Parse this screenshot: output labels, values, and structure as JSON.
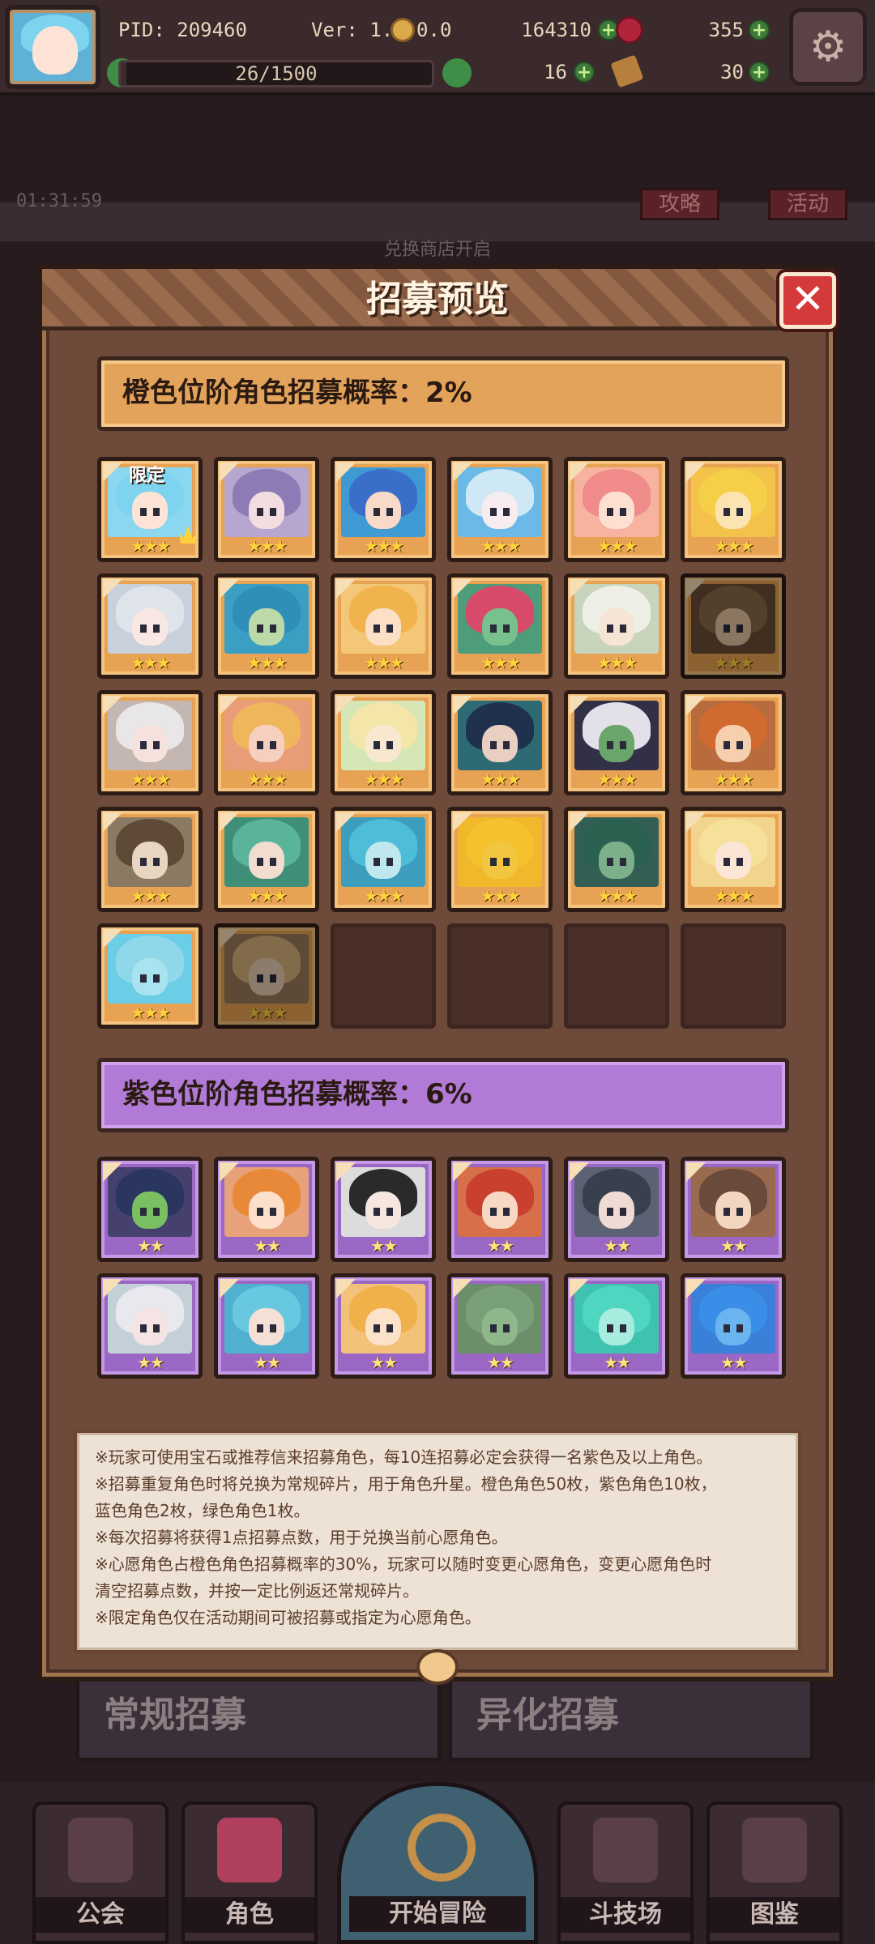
{
  "hud": {
    "pid": "PID: 209460",
    "version": "Ver: 1.0.0.0",
    "coins": "164310",
    "gems": "355",
    "exp": "26/1500",
    "exp_fraction": 0.017,
    "clover_count": "16",
    "ticket_count": "30",
    "plus_symbol": "+",
    "settings_icon": "gear-icon"
  },
  "background": {
    "timer": "01:31:59",
    "shop_notice": "兑换商店开启",
    "tags": [
      "攻略",
      "活动"
    ],
    "recruit_buttons": [
      "常规招募",
      "异化招募"
    ]
  },
  "popup": {
    "title": "招募预览",
    "close_symbol": "✕",
    "orange_tier_label": "橙色位阶角色招募概率：2%",
    "purple_tier_label": "紫色位阶角色招募概率：6%",
    "limited_tag": "限定",
    "orange_stars": "★★★",
    "purple_stars": "★★",
    "orange_characters": [
      {
        "hair": "#7ed4ee",
        "bg": "#8ad7ef",
        "skin": "#fde4d6",
        "limited": true
      },
      {
        "hair": "#8c7bb4",
        "bg": "#b7a6cf",
        "skin": "#f3dde0"
      },
      {
        "hair": "#3a6fc9",
        "bg": "#3f9ad4",
        "skin": "#f9d9c8"
      },
      {
        "hair": "#cfe8f6",
        "bg": "#6ab9e6",
        "skin": "#f7ecef"
      },
      {
        "hair": "#f08c8a",
        "bg": "#f7b3a0",
        "skin": "#fde0d2"
      },
      {
        "hair": "#f6cf48",
        "bg": "#f3c24a",
        "skin": "#fbe4b2"
      },
      {
        "hair": "#dfe3ea",
        "bg": "#c8d0dc",
        "skin": "#f8e7e2"
      },
      {
        "hair": "#2f8fb9",
        "bg": "#3a9fc2",
        "skin": "#bcd9a8"
      },
      {
        "hair": "#f0b34d",
        "bg": "#f4c778",
        "skin": "#fbe0c6"
      },
      {
        "hair": "#d84a6a",
        "bg": "#4d9c7a",
        "skin": "#78c08e"
      },
      {
        "hair": "#eef0e8",
        "bg": "#c9d4bd",
        "skin": "#f6e4d4"
      },
      {
        "hair": "#8a6a4a",
        "bg": "#6a4d36",
        "skin": "#e7c4a2",
        "dim": true
      },
      {
        "hair": "#e8e6e6",
        "bg": "#c4b6b0",
        "skin": "#f6e2dc"
      },
      {
        "hair": "#f0b65c",
        "bg": "#e89d78",
        "skin": "#f6cfbf"
      },
      {
        "hair": "#f4e6a8",
        "bg": "#d7e6b5",
        "skin": "#f9e8d0"
      },
      {
        "hair": "#20314e",
        "bg": "#2e6a74",
        "skin": "#e8cfc2"
      },
      {
        "hair": "#e4e0ea",
        "bg": "#313046",
        "skin": "#6aa56a"
      },
      {
        "hair": "#d16a2e",
        "bg": "#b86b3d",
        "skin": "#f6cfae"
      },
      {
        "hair": "#5e4a36",
        "bg": "#8a7a62",
        "skin": "#e9d6c2"
      },
      {
        "hair": "#5ab49a",
        "bg": "#3f8e78",
        "skin": "#f2dcd0"
      },
      {
        "hair": "#4ebdd8",
        "bg": "#3d9dbc",
        "skin": "#bfe7ee"
      },
      {
        "hair": "#f5c22e",
        "bg": "#f1b82c",
        "skin": "#f3c640"
      },
      {
        "hair": "#2a6050",
        "bg": "#325e54",
        "skin": "#7cb08a"
      },
      {
        "hair": "#f6e19a",
        "bg": "#f3d48c",
        "skin": "#fbe6d6"
      },
      {
        "hair": "#8fd8ea",
        "bg": "#6ccde6",
        "skin": "#a9e3ef"
      },
      {
        "hair": "#d8b37c",
        "bg": "#9a7a5a",
        "skin": "#e8cfb4",
        "dim": true
      }
    ],
    "orange_empty_slots": 4,
    "purple_characters": [
      {
        "hair": "#2a3560",
        "bg": "#45406e",
        "skin": "#7bbf63"
      },
      {
        "hair": "#e8893a",
        "bg": "#e7a27a",
        "skin": "#fde0cc"
      },
      {
        "hair": "#2a2a2a",
        "bg": "#dcdcdc",
        "skin": "#f5e6e0"
      },
      {
        "hair": "#c9402e",
        "bg": "#d7704a",
        "skin": "#f8d8c4"
      },
      {
        "hair": "#38404e",
        "bg": "#5a6274",
        "skin": "#f0dad4"
      },
      {
        "hair": "#6a4a3a",
        "bg": "#9a6a4e",
        "skin": "#f2d6c0"
      },
      {
        "hair": "#e8e8ee",
        "bg": "#c4d0d8",
        "skin": "#f4e4e4"
      },
      {
        "hair": "#67c8e0",
        "bg": "#4fb0d0",
        "skin": "#f4e0d4"
      },
      {
        "hair": "#f0b04a",
        "bg": "#f2c27a",
        "skin": "#fbe2c8"
      },
      {
        "hair": "#7aa07a",
        "bg": "#6d8e6a",
        "skin": "#8fb78c"
      },
      {
        "hair": "#4fd6c0",
        "bg": "#3fc2b0",
        "skin": "#a8ecdf"
      },
      {
        "hair": "#3a8ee8",
        "bg": "#3a7fd8",
        "skin": "#6ab4f0"
      }
    ],
    "notes": [
      "※玩家可使用宝石或推荐信来招募角色，每10连招募必定会获得一名紫色及以上角色。",
      "※招募重复角色时将兑换为常规碎片，用于角色升星。橙色角色50枚，紫色角色10枚，",
      "蓝色角色2枚，绿色角色1枚。",
      "※每次招募将获得1点招募点数，用于兑换当前心愿角色。",
      "※心愿角色占橙色角色招募概率的30%，玩家可以随时变更心愿角色，变更心愿角色时",
      "清空招募点数，并按一定比例返还常规碎片。",
      "※限定角色仅在活动期间可被招募或指定为心愿角色。"
    ]
  },
  "nav": {
    "items": [
      "公会",
      "角色",
      "开始冒险",
      "斗技场",
      "图鉴"
    ],
    "icons": [
      "guild-icon",
      "character-icon",
      "adventure-icon",
      "arena-icon",
      "codex-icon"
    ]
  }
}
